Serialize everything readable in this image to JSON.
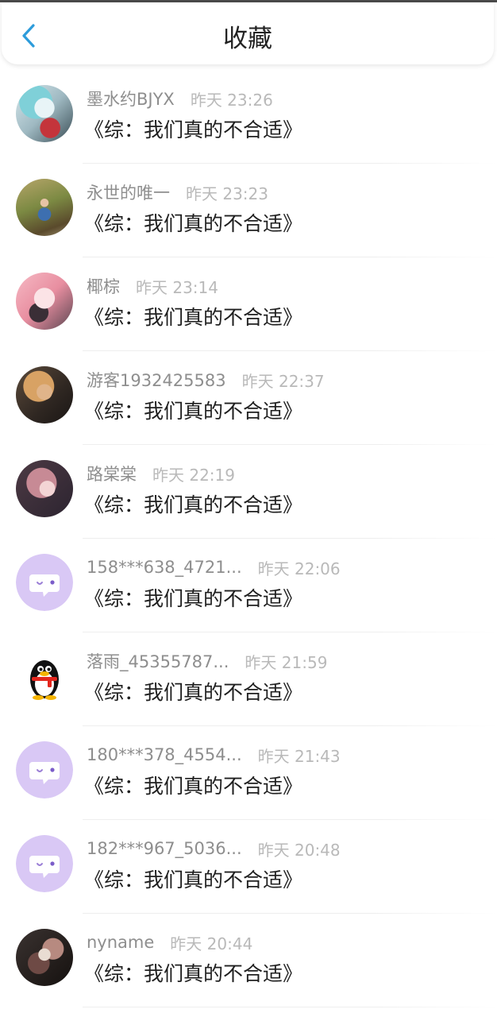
{
  "header": {
    "title": "收藏",
    "back_icon": "chevron-left-icon"
  },
  "colors": {
    "accent": "#2d9cdb",
    "placeholder_avatar": "#d9c8f5"
  },
  "items": [
    {
      "name": "墨水约BJYX",
      "time": "昨天 23:26",
      "book": "《综：我们真的不合适》",
      "avatar": "photo"
    },
    {
      "name": "永世的唯一",
      "time": "昨天 23:23",
      "book": "《综：我们真的不合适》",
      "avatar": "photo"
    },
    {
      "name": "椰棕",
      "time": "昨天 23:14",
      "book": "《综：我们真的不合适》",
      "avatar": "photo"
    },
    {
      "name": "游客1932425583",
      "time": "昨天 22:37",
      "book": "《综：我们真的不合适》",
      "avatar": "photo"
    },
    {
      "name": "路棠棠",
      "time": "昨天 22:19",
      "book": "《综：我们真的不合适》",
      "avatar": "photo"
    },
    {
      "name": "158***638_4721...",
      "time": "昨天 22:06",
      "book": "《综：我们真的不合适》",
      "avatar": "chat-bubble-icon"
    },
    {
      "name": "落雨_45355787...",
      "time": "昨天 21:59",
      "book": "《综：我们真的不合适》",
      "avatar": "penguin-icon"
    },
    {
      "name": "180***378_4554...",
      "time": "昨天 21:43",
      "book": "《综：我们真的不合适》",
      "avatar": "chat-bubble-icon"
    },
    {
      "name": "182***967_5036...",
      "time": "昨天 20:48",
      "book": "《综：我们真的不合适》",
      "avatar": "chat-bubble-icon"
    },
    {
      "name": "nyname",
      "time": "昨天 20:44",
      "book": "《综：我们真的不合适》",
      "avatar": "photo"
    }
  ]
}
